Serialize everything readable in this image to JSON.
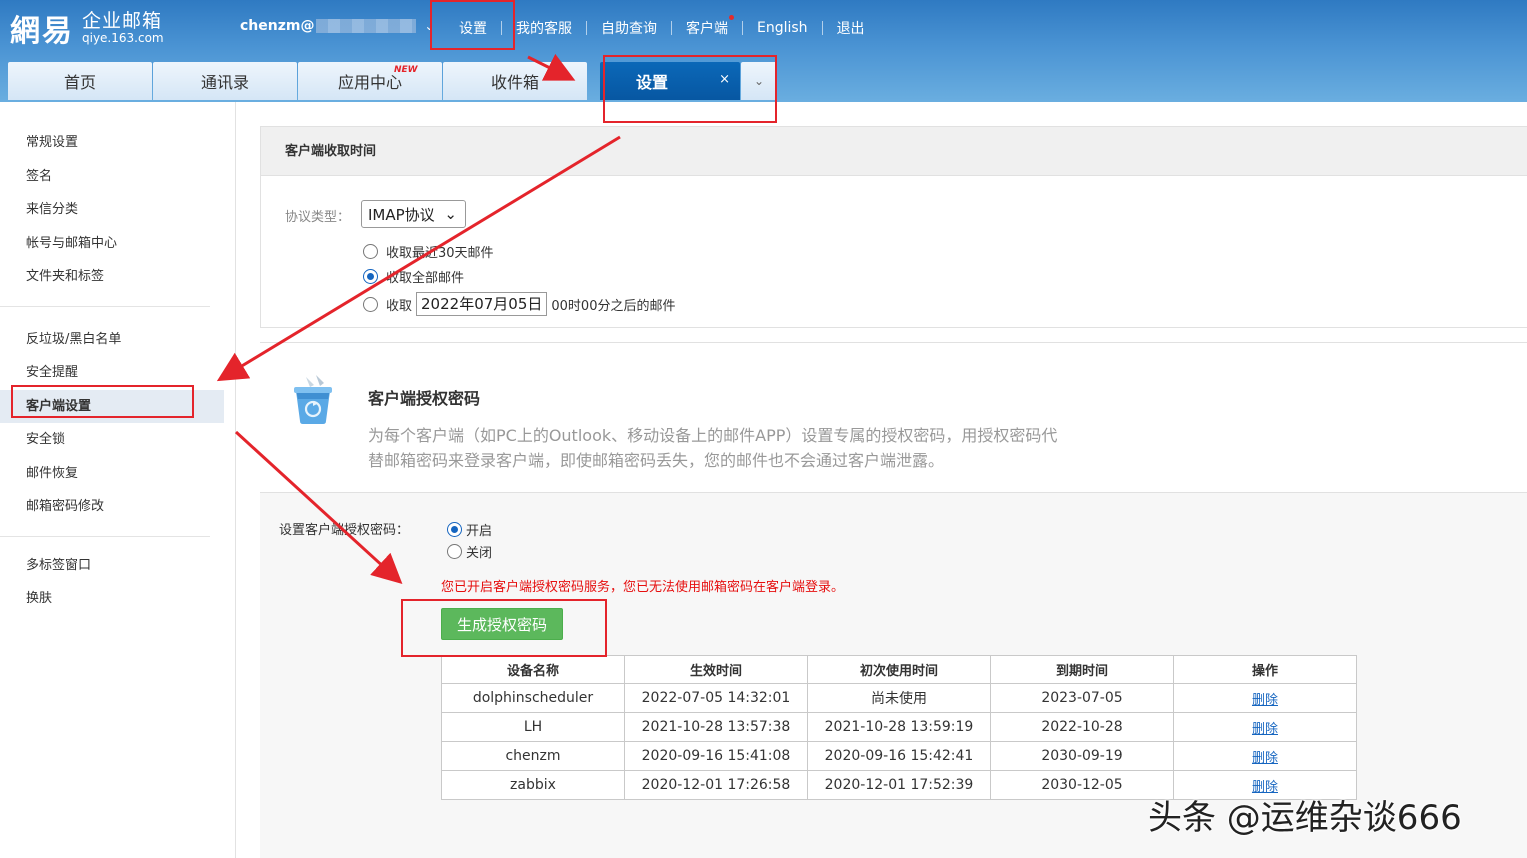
{
  "header": {
    "logo_mark": "網易",
    "logo_cn": "企业邮箱",
    "logo_en": "qiye.163.com",
    "user": "chenzm@",
    "nav": [
      "设置",
      "我的客服",
      "自助查询",
      "客户端",
      "English",
      "退出"
    ]
  },
  "tabs": {
    "items": [
      "首页",
      "通讯录",
      "应用中心",
      "收件箱"
    ],
    "new_badge": "NEW",
    "active": "设置",
    "close": "×",
    "more": "⌄"
  },
  "sidebar": {
    "group1": [
      "常规设置",
      "签名",
      "来信分类",
      "帐号与邮箱中心",
      "文件夹和标签"
    ],
    "group2": [
      "反垃圾/黑白名单",
      "安全提醒",
      "客户端设置",
      "安全锁",
      "邮件恢复",
      "邮箱密码修改"
    ],
    "group3": [
      "多标签窗口",
      "换肤"
    ]
  },
  "client_fetch": {
    "title": "客户端收取时间",
    "protocol_label": "协议类型：",
    "protocol_value": "IMAP协议",
    "opt_recent": "收取最近30天邮件",
    "opt_all": "收取全部邮件",
    "opt_from_prefix": "收取",
    "opt_from_date": "2022年07月05日",
    "opt_from_suffix": "00时00分之后的邮件"
  },
  "auth": {
    "title": "客户端授权密码",
    "desc": "为每个客户端（如PC上的Outlook、移动设备上的邮件APP）设置专属的授权密码，用授权密码代替邮箱密码来登录客户端，即使邮箱密码丢失，您的邮件也不会通过客户端泄露。",
    "setting_label": "设置客户端授权密码：",
    "opt_on": "开启",
    "opt_off": "关闭",
    "warning": "您已开启客户端授权密码服务，您已无法使用邮箱密码在客户端登录。",
    "generate_button": "生成授权密码"
  },
  "devices": {
    "headers": [
      "设备名称",
      "生效时间",
      "初次使用时间",
      "到期时间",
      "操作"
    ],
    "rows": [
      [
        "dolphinscheduler",
        "2022-07-05 14:32:01",
        "尚未使用",
        "2023-07-05",
        "删除"
      ],
      [
        "LH",
        "2021-10-28 13:57:38",
        "2021-10-28 13:59:19",
        "2022-10-28",
        "删除"
      ],
      [
        "chenzm",
        "2020-09-16 15:41:08",
        "2020-09-16 15:42:41",
        "2030-09-19",
        "删除"
      ],
      [
        "zabbix",
        "2020-12-01 17:26:58",
        "2020-12-01 17:52:39",
        "2030-12-05",
        "删除"
      ]
    ]
  },
  "watermark": "头条 @运维杂谈666",
  "colors": {
    "annotation_red": "#e4242b",
    "active_tab": "#0757a2",
    "generate_green": "#5cb85c",
    "warning_red": "#e60f0f",
    "link_blue": "#1565c0"
  }
}
